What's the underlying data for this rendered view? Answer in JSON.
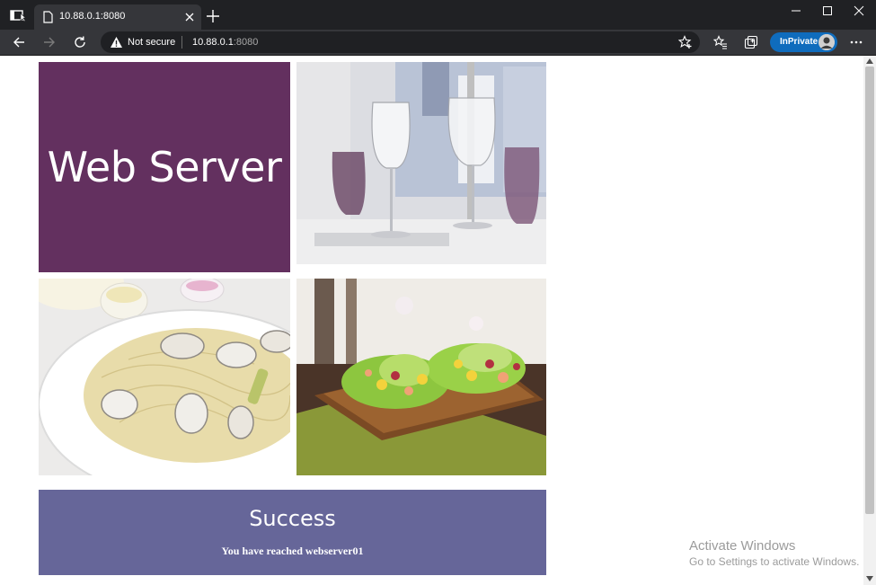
{
  "browser": {
    "tab_title": "10.88.0.1:8080",
    "security_label": "Not secure",
    "url_host": "10.88.0.1",
    "url_port": ":8080",
    "inprivate_label": "InPrivate",
    "icons": {
      "tab_actions": "tab-actions-icon",
      "new_tab": "plus-icon",
      "back": "back-arrow-icon",
      "forward": "forward-arrow-icon",
      "refresh": "refresh-icon",
      "warning": "warning-icon",
      "add_favorite": "add-favorite-icon",
      "favorites": "favorites-icon",
      "collections": "collections-icon",
      "more": "more-icon",
      "minimize": "minimize-icon",
      "maximize": "maximize-icon",
      "close": "close-icon"
    }
  },
  "page": {
    "hero_title": "Web Server",
    "banner_title": "Success",
    "banner_subtitle": "You have reached webserver01",
    "colors": {
      "hero_bg": "#63305f",
      "banner_bg": "#666699"
    },
    "images": [
      "wine-glasses-photo",
      "clam-pasta-photo",
      "shrimp-lettuce-wraps-photo"
    ]
  },
  "watermark": {
    "title": "Activate Windows",
    "subtitle": "Go to Settings to activate Windows."
  }
}
